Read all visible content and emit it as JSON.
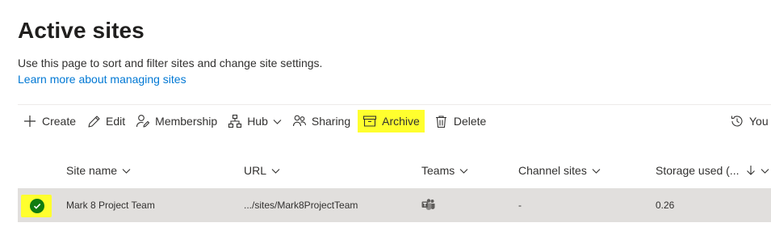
{
  "page": {
    "title": "Active sites",
    "description": "Use this page to sort and filter sites and change site settings.",
    "learn_more": "Learn more about managing sites"
  },
  "toolbar": {
    "create": "Create",
    "edit": "Edit",
    "membership": "Membership",
    "hub": "Hub",
    "sharing": "Sharing",
    "archive": "Archive",
    "delete": "Delete",
    "you": "You"
  },
  "columns": {
    "site_name": "Site name",
    "url": "URL",
    "teams": "Teams",
    "channel_sites": "Channel sites",
    "storage_used": "Storage used (..."
  },
  "rows": [
    {
      "site_name": "Mark 8 Project Team",
      "url": ".../sites/Mark8ProjectTeam",
      "teams_icon": "teams-icon",
      "channel_sites": "-",
      "storage_used": "0.26",
      "selected": true
    }
  ],
  "colors": {
    "accent": "#0078d4",
    "highlight": "#ffff2e",
    "selected_check": "#107c10",
    "selected_row": "#e1dfdd"
  }
}
